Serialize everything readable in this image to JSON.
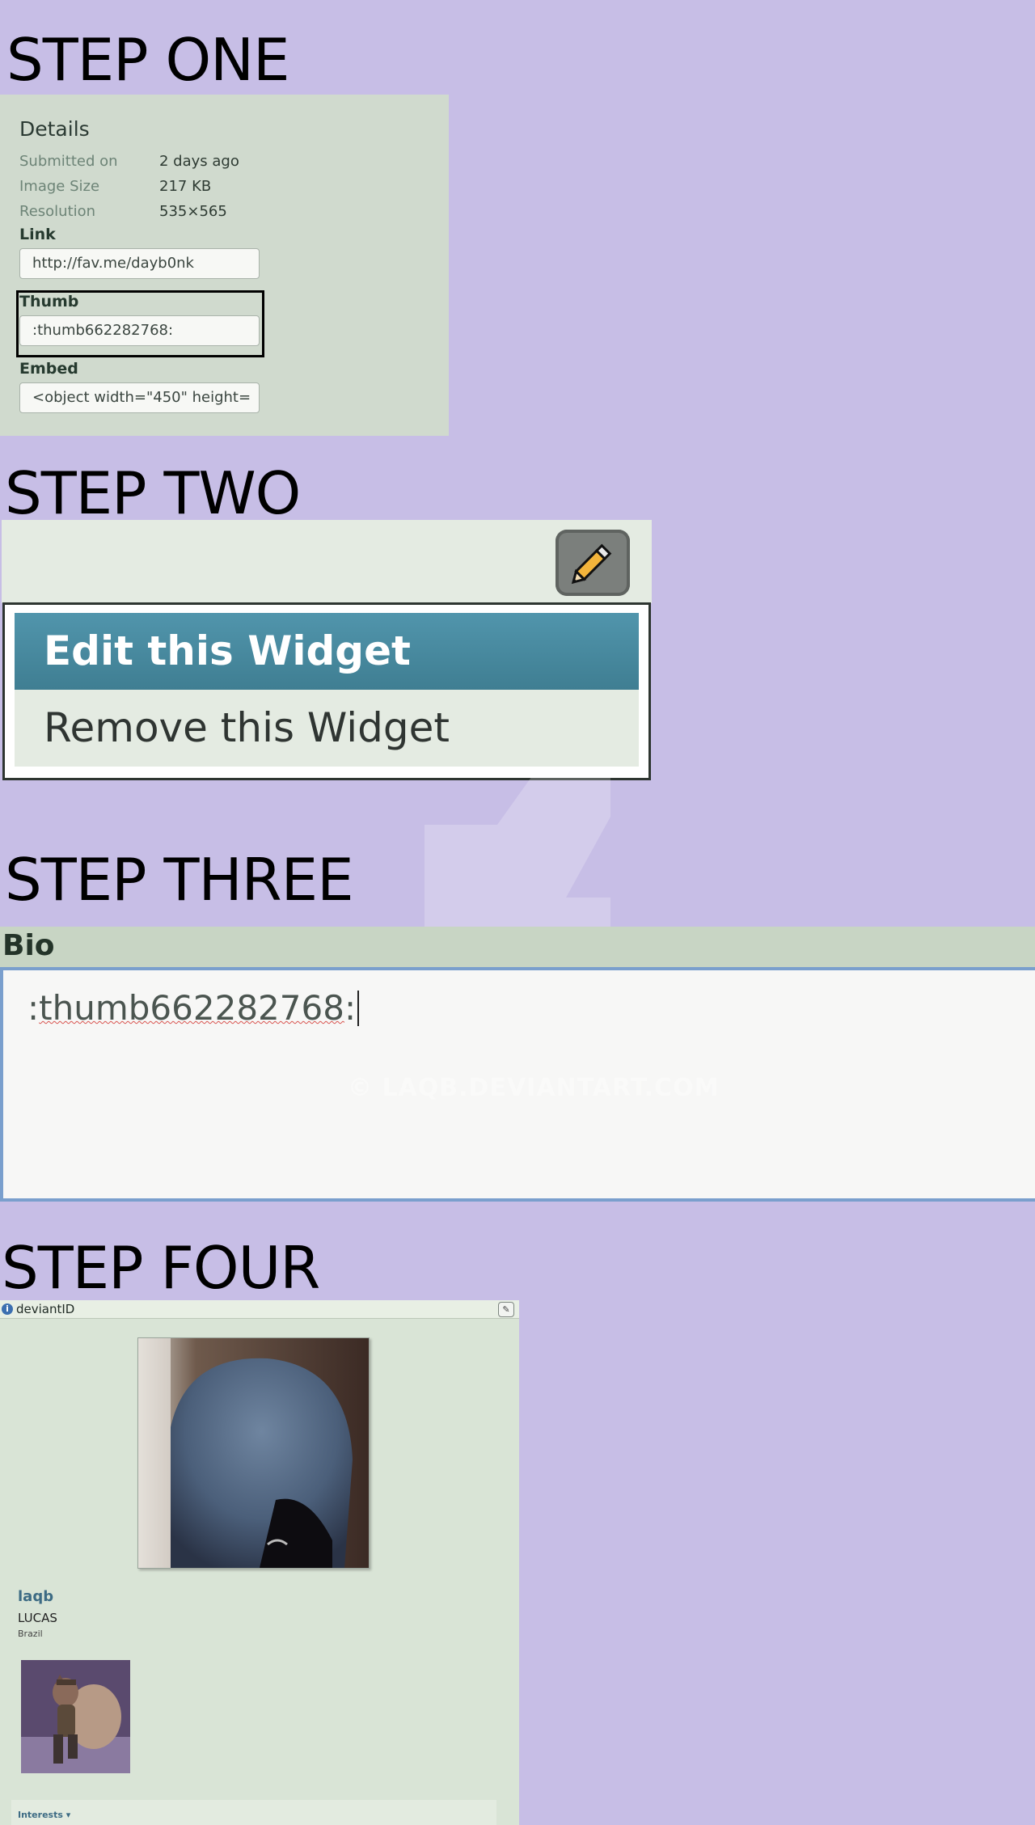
{
  "steps": {
    "one": "STEP ONE",
    "two": "STEP TWO",
    "three": "STEP THREE",
    "four": "STEP FOUR"
  },
  "details": {
    "title": "Details",
    "rows": [
      {
        "label": "Submitted on",
        "value": "2 days ago"
      },
      {
        "label": "Image Size",
        "value": "217 KB"
      },
      {
        "label": "Resolution",
        "value": "535×565"
      }
    ],
    "link_label": "Link",
    "link_value": "http://fav.me/dayb0nk",
    "thumb_label": "Thumb",
    "thumb_value": ":thumb662282768:",
    "embed_label": "Embed",
    "embed_value": "<object width=\"450\" height="
  },
  "widget_menu": {
    "edit": "Edit this Widget",
    "remove": "Remove this Widget",
    "icon": "pencil-icon"
  },
  "bio": {
    "label": "Bio",
    "prefix": ":",
    "text": "thumb662282768",
    "suffix": ":"
  },
  "watermark": {
    "text": "© LAQB.DEVIANTART.COM"
  },
  "deviant_id": {
    "title": "deviantID",
    "info_icon": "i",
    "username": "laqb",
    "real_name": "LUCAS",
    "country": "Brazil",
    "interests_label": "Interests ▾"
  },
  "colors": {
    "background": "#c7bee6",
    "panel": "#d0dace",
    "menu_highlight": "#4a8aa0",
    "bio_border": "#7a9fcd"
  }
}
